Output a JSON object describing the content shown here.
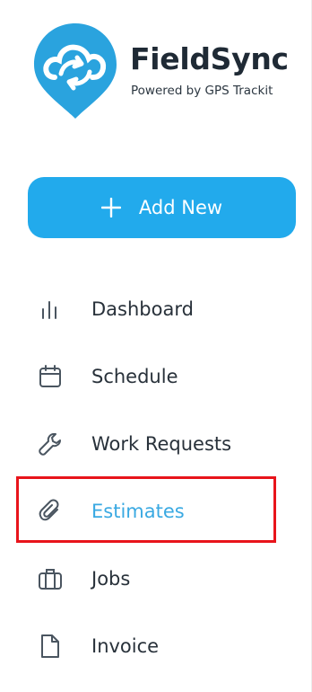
{
  "brand": {
    "name": "FieldSync",
    "tagline": "Powered by GPS Trackit",
    "color": "#2aa3de"
  },
  "actions": {
    "add_new_label": "Add New",
    "add_new_color": "#22aaec"
  },
  "nav": {
    "items": [
      {
        "label": "Dashboard",
        "icon": "bar-chart-icon",
        "active": false
      },
      {
        "label": "Schedule",
        "icon": "calendar-icon",
        "active": false
      },
      {
        "label": "Work Requests",
        "icon": "wrench-icon",
        "active": false
      },
      {
        "label": "Estimates",
        "icon": "paperclip-icon",
        "active": true
      },
      {
        "label": "Jobs",
        "icon": "briefcase-icon",
        "active": false
      },
      {
        "label": "Invoice",
        "icon": "document-icon",
        "active": false
      }
    ],
    "active_color": "#3aa9e2"
  }
}
